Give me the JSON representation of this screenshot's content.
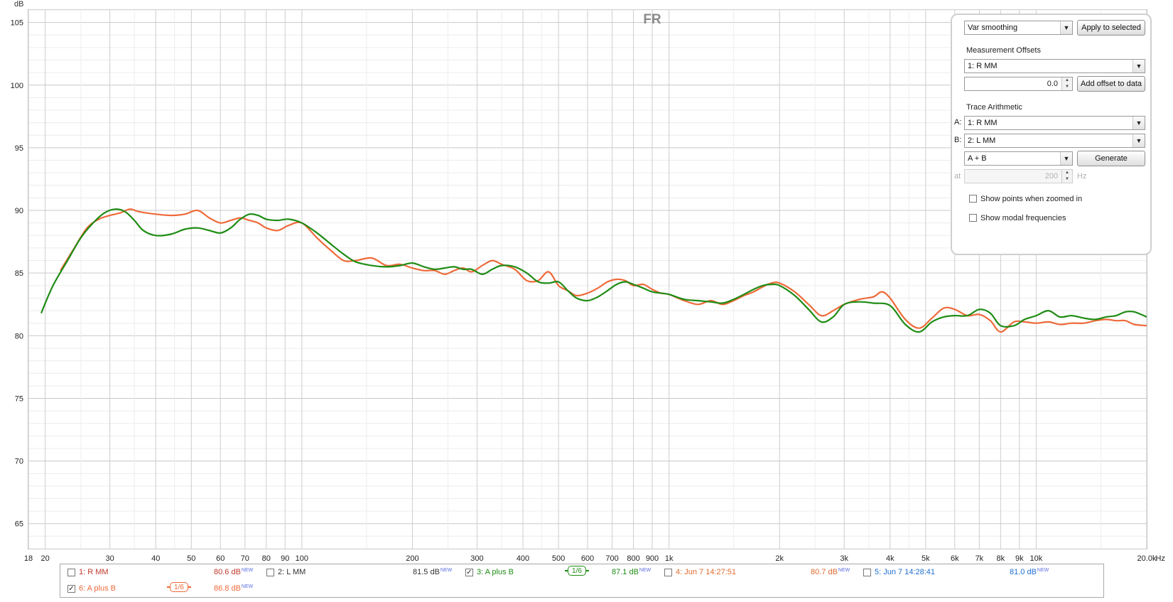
{
  "graph": {
    "title": "FR",
    "y_unit": "dB",
    "x_unit": "Hz"
  },
  "chart_data": {
    "type": "line",
    "title": "FR",
    "ylabel": "dB",
    "xlabel": "Hz",
    "x_scale": "log",
    "xlim": [
      18,
      20000
    ],
    "ylim": [
      63,
      106
    ],
    "grid": true,
    "y_ticks": [
      65,
      70,
      75,
      80,
      85,
      90,
      95,
      100,
      105
    ],
    "x_ticks": [
      {
        "v": 18,
        "label": "18"
      },
      {
        "v": 20,
        "label": "20"
      },
      {
        "v": 30,
        "label": "30"
      },
      {
        "v": 40,
        "label": "40"
      },
      {
        "v": 50,
        "label": "50"
      },
      {
        "v": 60,
        "label": "60"
      },
      {
        "v": 70,
        "label": "70"
      },
      {
        "v": 80,
        "label": "80"
      },
      {
        "v": 90,
        "label": "90"
      },
      {
        "v": 100,
        "label": "100"
      },
      {
        "v": 200,
        "label": "200"
      },
      {
        "v": 300,
        "label": "300"
      },
      {
        "v": 400,
        "label": "400"
      },
      {
        "v": 500,
        "label": "500"
      },
      {
        "v": 600,
        "label": "600"
      },
      {
        "v": 700,
        "label": "700"
      },
      {
        "v": 800,
        "label": "800"
      },
      {
        "v": 900,
        "label": "900"
      },
      {
        "v": 1000,
        "label": "1k"
      },
      {
        "v": 2000,
        "label": "2k"
      },
      {
        "v": 3000,
        "label": "3k"
      },
      {
        "v": 4000,
        "label": "4k"
      },
      {
        "v": 5000,
        "label": "5k"
      },
      {
        "v": 6000,
        "label": "6k"
      },
      {
        "v": 7000,
        "label": "7k"
      },
      {
        "v": 8000,
        "label": "8k"
      },
      {
        "v": 9000,
        "label": "9k"
      },
      {
        "v": 10000,
        "label": "10k"
      },
      {
        "v": 20000,
        "label": "20.0k"
      }
    ],
    "series": [
      {
        "name": "3: A plus B",
        "color": "#1e8c14",
        "points": [
          [
            19.5,
            81.8
          ],
          [
            21,
            84.0
          ],
          [
            23,
            86.0
          ],
          [
            25,
            87.8
          ],
          [
            27,
            89.0
          ],
          [
            29,
            89.8
          ],
          [
            31,
            90.1
          ],
          [
            33,
            89.9
          ],
          [
            35,
            89.2
          ],
          [
            37,
            88.4
          ],
          [
            40,
            88.0
          ],
          [
            44,
            88.1
          ],
          [
            48,
            88.5
          ],
          [
            52,
            88.6
          ],
          [
            56,
            88.4
          ],
          [
            60,
            88.2
          ],
          [
            64,
            88.6
          ],
          [
            68,
            89.3
          ],
          [
            72,
            89.7
          ],
          [
            76,
            89.6
          ],
          [
            80,
            89.3
          ],
          [
            86,
            89.2
          ],
          [
            92,
            89.3
          ],
          [
            100,
            89.0
          ],
          [
            110,
            88.2
          ],
          [
            120,
            87.3
          ],
          [
            130,
            86.5
          ],
          [
            140,
            85.9
          ],
          [
            155,
            85.6
          ],
          [
            170,
            85.5
          ],
          [
            185,
            85.6
          ],
          [
            200,
            85.8
          ],
          [
            215,
            85.5
          ],
          [
            230,
            85.3
          ],
          [
            245,
            85.4
          ],
          [
            260,
            85.5
          ],
          [
            275,
            85.3
          ],
          [
            290,
            85.3
          ],
          [
            310,
            84.9
          ],
          [
            330,
            85.3
          ],
          [
            350,
            85.6
          ],
          [
            380,
            85.5
          ],
          [
            410,
            85.0
          ],
          [
            440,
            84.3
          ],
          [
            470,
            84.2
          ],
          [
            500,
            84.3
          ],
          [
            530,
            83.6
          ],
          [
            560,
            83.0
          ],
          [
            600,
            82.8
          ],
          [
            640,
            83.1
          ],
          [
            680,
            83.6
          ],
          [
            720,
            84.1
          ],
          [
            760,
            84.3
          ],
          [
            800,
            84.1
          ],
          [
            850,
            83.8
          ],
          [
            900,
            83.5
          ],
          [
            950,
            83.4
          ],
          [
            1000,
            83.3
          ],
          [
            1100,
            82.9
          ],
          [
            1200,
            82.8
          ],
          [
            1300,
            82.7
          ],
          [
            1400,
            82.6
          ],
          [
            1500,
            82.9
          ],
          [
            1600,
            83.3
          ],
          [
            1700,
            83.7
          ],
          [
            1800,
            84.0
          ],
          [
            1900,
            84.1
          ],
          [
            2000,
            84.0
          ],
          [
            2200,
            83.2
          ],
          [
            2400,
            82.1
          ],
          [
            2600,
            81.1
          ],
          [
            2800,
            81.5
          ],
          [
            3000,
            82.5
          ],
          [
            3300,
            82.7
          ],
          [
            3600,
            82.6
          ],
          [
            4000,
            82.4
          ],
          [
            4400,
            80.9
          ],
          [
            4800,
            80.3
          ],
          [
            5200,
            81.1
          ],
          [
            5600,
            81.5
          ],
          [
            6000,
            81.6
          ],
          [
            6500,
            81.6
          ],
          [
            7000,
            82.1
          ],
          [
            7500,
            81.8
          ],
          [
            8000,
            80.8
          ],
          [
            8700,
            80.8
          ],
          [
            9300,
            81.3
          ],
          [
            10000,
            81.6
          ],
          [
            10800,
            82.0
          ],
          [
            11600,
            81.5
          ],
          [
            12500,
            81.6
          ],
          [
            13500,
            81.4
          ],
          [
            14500,
            81.3
          ],
          [
            15500,
            81.5
          ],
          [
            16500,
            81.6
          ],
          [
            17500,
            81.9
          ],
          [
            18500,
            81.9
          ],
          [
            20000,
            81.5
          ]
        ]
      },
      {
        "name": "6: A plus B",
        "color": "#ee6a3a",
        "points": [
          [
            22,
            85.2
          ],
          [
            24,
            87.0
          ],
          [
            26,
            88.6
          ],
          [
            28,
            89.3
          ],
          [
            30,
            89.6
          ],
          [
            32,
            89.8
          ],
          [
            34,
            90.1
          ],
          [
            36,
            89.9
          ],
          [
            40,
            89.7
          ],
          [
            44,
            89.6
          ],
          [
            48,
            89.7
          ],
          [
            52,
            90.0
          ],
          [
            56,
            89.4
          ],
          [
            60,
            89.0
          ],
          [
            64,
            89.2
          ],
          [
            68,
            89.4
          ],
          [
            72,
            89.2
          ],
          [
            76,
            89.0
          ],
          [
            80,
            88.6
          ],
          [
            86,
            88.4
          ],
          [
            92,
            88.8
          ],
          [
            100,
            89.0
          ],
          [
            110,
            87.8
          ],
          [
            120,
            86.8
          ],
          [
            130,
            86.0
          ],
          [
            140,
            86.0
          ],
          [
            155,
            86.2
          ],
          [
            170,
            85.6
          ],
          [
            185,
            85.7
          ],
          [
            200,
            85.4
          ],
          [
            215,
            85.2
          ],
          [
            230,
            85.2
          ],
          [
            245,
            84.9
          ],
          [
            260,
            85.2
          ],
          [
            275,
            85.4
          ],
          [
            290,
            85.1
          ],
          [
            310,
            85.6
          ],
          [
            330,
            86.0
          ],
          [
            350,
            85.7
          ],
          [
            380,
            85.3
          ],
          [
            410,
            84.4
          ],
          [
            440,
            84.4
          ],
          [
            470,
            85.1
          ],
          [
            500,
            84.0
          ],
          [
            530,
            83.6
          ],
          [
            560,
            83.2
          ],
          [
            600,
            83.4
          ],
          [
            640,
            83.8
          ],
          [
            680,
            84.3
          ],
          [
            720,
            84.5
          ],
          [
            760,
            84.4
          ],
          [
            800,
            84.0
          ],
          [
            850,
            84.1
          ],
          [
            900,
            83.7
          ],
          [
            950,
            83.4
          ],
          [
            1000,
            83.3
          ],
          [
            1100,
            82.8
          ],
          [
            1200,
            82.5
          ],
          [
            1300,
            82.8
          ],
          [
            1400,
            82.5
          ],
          [
            1500,
            82.8
          ],
          [
            1600,
            83.2
          ],
          [
            1700,
            83.5
          ],
          [
            1800,
            83.9
          ],
          [
            1900,
            84.2
          ],
          [
            2000,
            84.2
          ],
          [
            2200,
            83.5
          ],
          [
            2400,
            82.5
          ],
          [
            2600,
            81.6
          ],
          [
            2800,
            82.0
          ],
          [
            3000,
            82.5
          ],
          [
            3300,
            82.9
          ],
          [
            3600,
            83.1
          ],
          [
            3800,
            83.5
          ],
          [
            4000,
            83.0
          ],
          [
            4400,
            81.3
          ],
          [
            4800,
            80.6
          ],
          [
            5200,
            81.4
          ],
          [
            5600,
            82.2
          ],
          [
            6000,
            82.1
          ],
          [
            6500,
            81.6
          ],
          [
            7000,
            81.7
          ],
          [
            7500,
            81.2
          ],
          [
            8000,
            80.3
          ],
          [
            8700,
            81.1
          ],
          [
            9300,
            81.1
          ],
          [
            10000,
            81.0
          ],
          [
            10800,
            81.1
          ],
          [
            11600,
            80.9
          ],
          [
            12500,
            81.0
          ],
          [
            13500,
            81.0
          ],
          [
            14500,
            81.2
          ],
          [
            15500,
            81.3
          ],
          [
            16500,
            81.2
          ],
          [
            17500,
            81.2
          ],
          [
            18500,
            80.9
          ],
          [
            20000,
            80.8
          ]
        ]
      }
    ]
  },
  "panel": {
    "smoothing": {
      "value": "Var smoothing",
      "apply_label": "Apply to selected"
    },
    "offsets": {
      "heading": "Measurement Offsets",
      "measurement": "1: R MM",
      "offset_value": "0.0",
      "add_label": "Add offset to data"
    },
    "arithmetic": {
      "heading": "Trace Arithmetic",
      "a_label": "A:",
      "a_value": "1: R MM",
      "b_label": "B:",
      "b_value": "2: L MM",
      "op_value": "A + B",
      "generate_label": "Generate",
      "at_label": "at",
      "at_value": "200",
      "hz_label": "Hz"
    },
    "show_points": "Show points when zoomed in",
    "show_modal": "Show modal frequencies"
  },
  "legend": {
    "items": [
      {
        "name": "1: R MM",
        "value": "80.6 dB",
        "tag": "NEW",
        "checked": false,
        "color": "#c0392b"
      },
      {
        "name": "2: L MM",
        "value": "81.5 dB",
        "tag": "NEW",
        "checked": false,
        "color": "#333333"
      },
      {
        "name": "3: A plus B",
        "value": "87.1 dB",
        "tag": "NEW",
        "checked": true,
        "color": "#1e8c14",
        "smoothing": "1/6"
      },
      {
        "name": "4: Jun 7 14:27:51",
        "value": "80.7 dB",
        "tag": "NEW",
        "checked": false,
        "color": "#e06a2f"
      },
      {
        "name": "5: Jun 7 14:28:41",
        "value": "81.0 dB",
        "tag": "NEW",
        "checked": false,
        "color": "#1f6fd1"
      },
      {
        "name": "6: A plus B",
        "value": "86.8 dB",
        "tag": "NEW",
        "checked": true,
        "color": "#ee6a3a",
        "smoothing": "1/6"
      }
    ]
  },
  "checkmark": "✓",
  "arrow_glyph": "▼"
}
